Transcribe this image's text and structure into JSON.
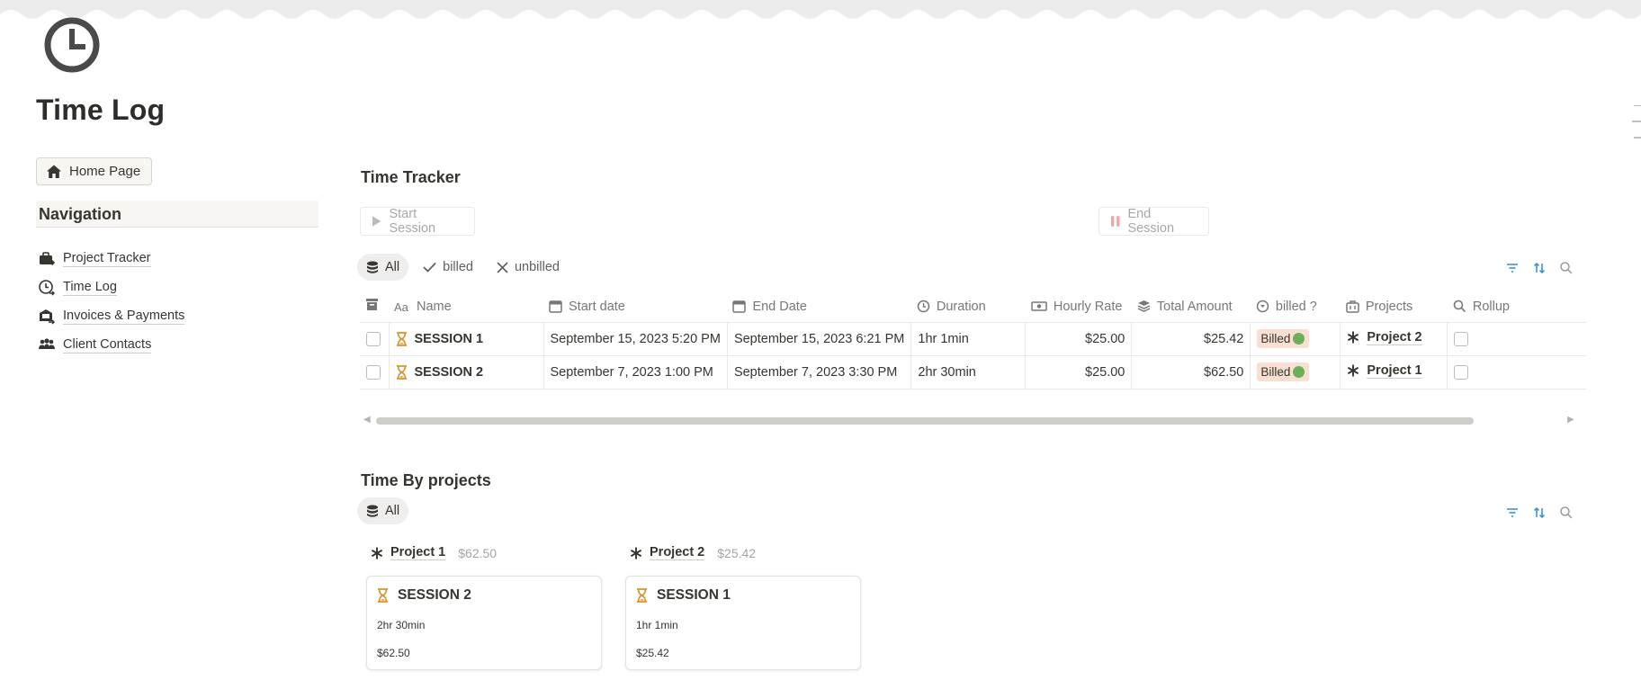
{
  "page": {
    "title": "Time Log",
    "icon": "clock-icon"
  },
  "home_button": {
    "label": "Home Page",
    "icon": "home-icon"
  },
  "navigation": {
    "heading": "Navigation",
    "items": [
      {
        "label": "Project Tracker",
        "icon": "briefcase-link-icon"
      },
      {
        "label": "Time Log",
        "icon": "clock-link-icon"
      },
      {
        "label": "Invoices & Payments",
        "icon": "invoice-link-icon"
      },
      {
        "label": "Client Contacts",
        "icon": "people-link-icon"
      }
    ]
  },
  "time_tracker": {
    "title": "Time Tracker",
    "start_button": "Start Session",
    "end_button": "End Session",
    "tabs": [
      {
        "label": "All",
        "icon": "database-icon",
        "active": true
      },
      {
        "label": "billed",
        "icon": "check-icon",
        "active": false
      },
      {
        "label": "unbilled",
        "icon": "x-icon",
        "active": false
      }
    ],
    "columns": [
      {
        "label": "Name",
        "icon": "text-aa-icon"
      },
      {
        "label": "Start date",
        "icon": "calendar-icon"
      },
      {
        "label": "End Date",
        "icon": "calendar-icon"
      },
      {
        "label": "Duration",
        "icon": "clock-icon"
      },
      {
        "label": "Hourly Rate",
        "icon": "money-icon"
      },
      {
        "label": "Total Amount",
        "icon": "stack-icon"
      },
      {
        "label": "billed ?",
        "icon": "select-icon"
      },
      {
        "label": "Projects",
        "icon": "relation-icon"
      },
      {
        "label": "Rollup",
        "icon": "search-icon"
      }
    ],
    "rows": [
      {
        "name": "SESSION 1",
        "start": "September 15, 2023 5:20 PM",
        "end": "September 15, 2023 6:21 PM",
        "duration": "1hr 1min",
        "rate": "$25.00",
        "total": "$25.42",
        "billed": "Billed",
        "project": "Project 2"
      },
      {
        "name": "SESSION 2",
        "start": "September 7, 2023 1:00 PM",
        "end": "September 7, 2023 3:30 PM",
        "duration": "2hr 30min",
        "rate": "$25.00",
        "total": "$62.50",
        "billed": "Billed",
        "project": "Project 1"
      }
    ]
  },
  "time_by_projects": {
    "title": "Time By projects",
    "tab": "All",
    "groups": [
      {
        "name": "Project 1",
        "sum": "$62.50",
        "card": {
          "title": "SESSION 2",
          "duration": "2hr 30min",
          "amount": "$62.50"
        }
      },
      {
        "name": "Project 2",
        "sum": "$25.42",
        "card": {
          "title": "SESSION 1",
          "duration": "1hr 1min",
          "amount": "$25.42"
        }
      }
    ]
  },
  "colors": {
    "accent_blue": "#2f8fd8",
    "hourglass": "#d9932a",
    "billed_bg": "#f8dfd2",
    "billed_dot": "#6bb058"
  }
}
